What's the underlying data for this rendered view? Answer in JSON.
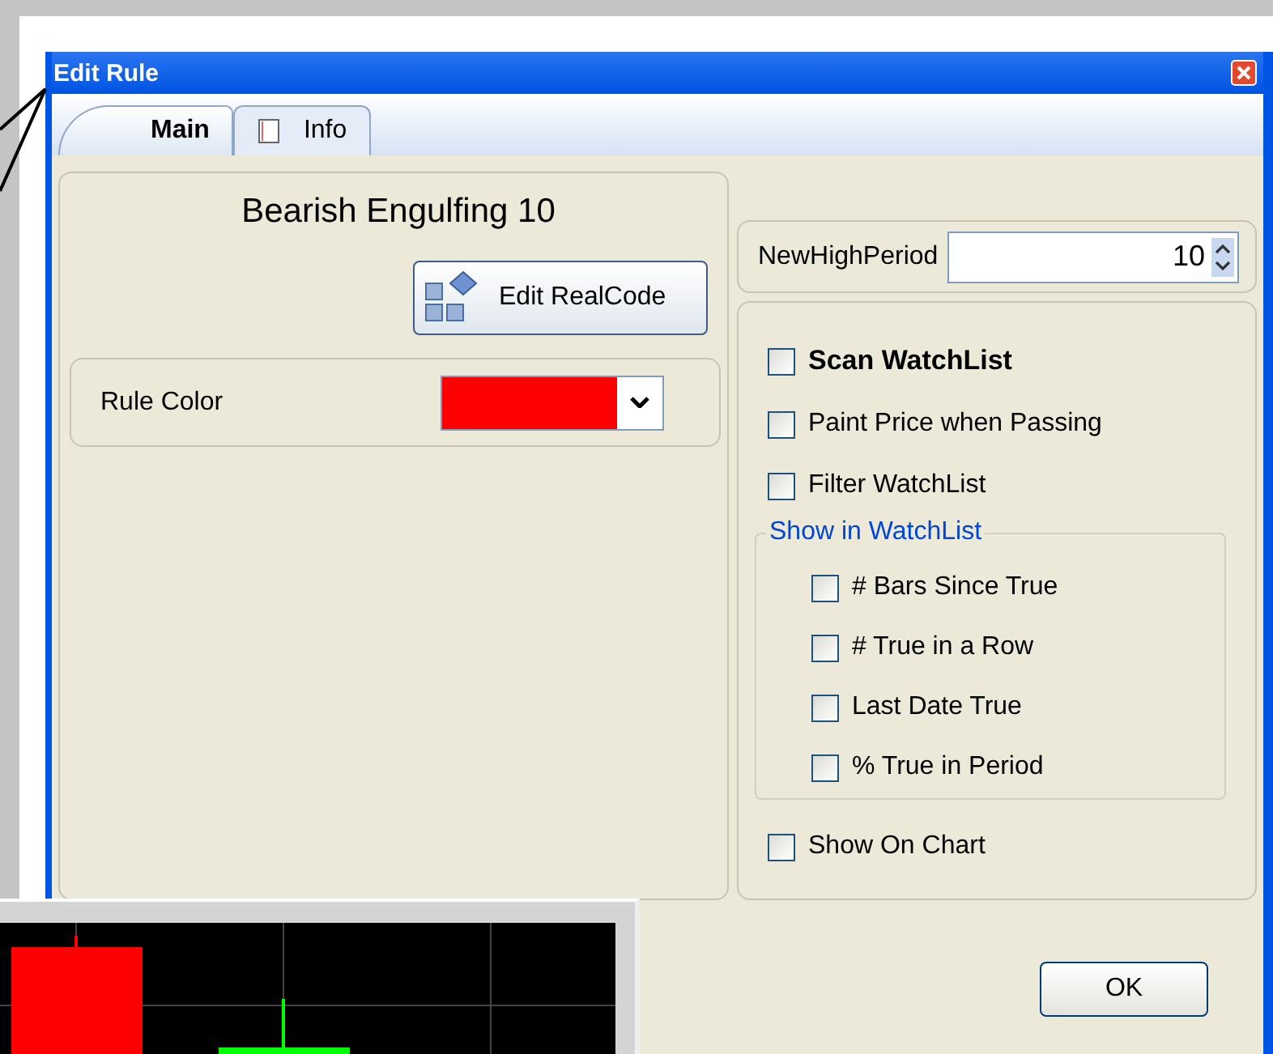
{
  "window": {
    "title": "Edit Rule"
  },
  "tabs": [
    {
      "label": "Main",
      "selected": true,
      "icon": false
    },
    {
      "label": "Info",
      "selected": false,
      "icon": true
    }
  ],
  "rule_name": "Bearish Engulfing 10",
  "edit_button": "Edit RealCode",
  "rule_color": {
    "label": "Rule Color",
    "color": "#ff0000"
  },
  "new_high_period": {
    "label": "NewHighPeriod",
    "value": "10"
  },
  "options": [
    {
      "label": "Scan WatchList",
      "checked": false,
      "bold": true
    },
    {
      "label": "Paint Price when Passing",
      "checked": false,
      "bold": false
    },
    {
      "label": "Filter WatchList",
      "checked": false,
      "bold": false
    }
  ],
  "show_in_watchlist": {
    "title": "Show in WatchList",
    "items": [
      {
        "label": "# Bars Since True",
        "checked": false
      },
      {
        "label": "# True in a Row",
        "checked": false
      },
      {
        "label": "Last Date True",
        "checked": false
      },
      {
        "label": "% True in Period",
        "checked": false
      }
    ]
  },
  "show_on_chart": {
    "label": "Show On Chart",
    "checked": false
  },
  "ok_button": "OK"
}
